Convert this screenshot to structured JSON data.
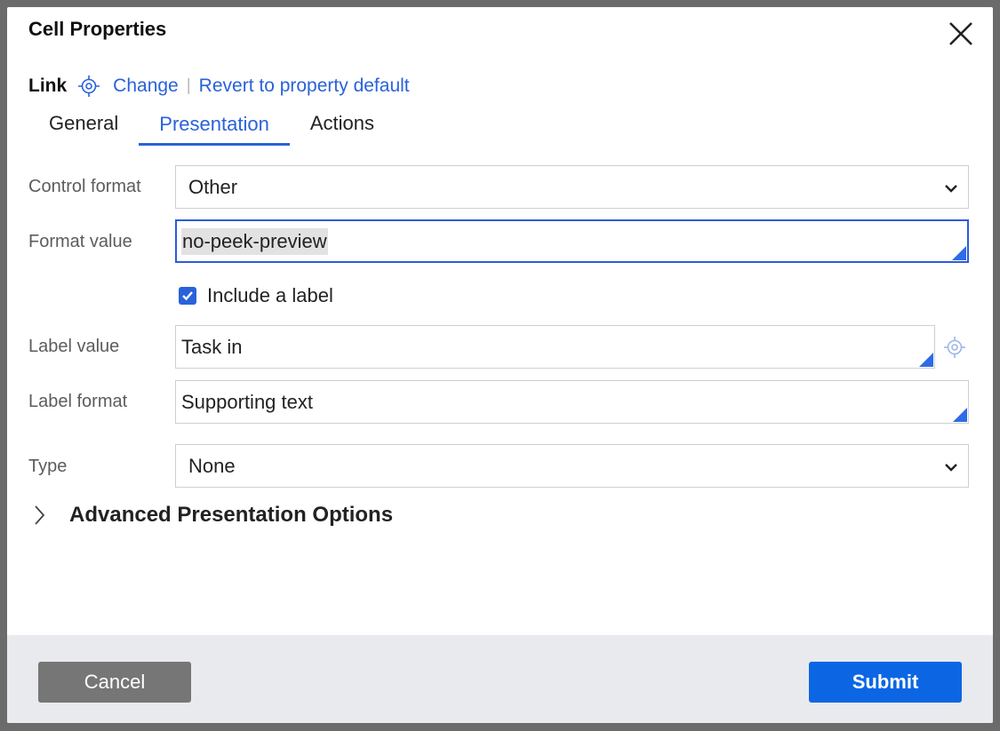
{
  "dialog": {
    "title": "Cell Properties"
  },
  "link": {
    "label": "Link",
    "change": "Change",
    "separator": "|",
    "revert": "Revert to property default"
  },
  "tabs": [
    {
      "label": "General",
      "active": false
    },
    {
      "label": "Presentation",
      "active": true
    },
    {
      "label": "Actions",
      "active": false
    }
  ],
  "fields": {
    "control_format": {
      "label": "Control format",
      "value": "Other"
    },
    "format_value": {
      "label": "Format value",
      "value": "no-peek-preview"
    },
    "include_label": {
      "label": "Include a label",
      "checked": true
    },
    "label_value": {
      "label": "Label value",
      "value": "Task in"
    },
    "label_format": {
      "label": "Label format",
      "value": "Supporting text"
    },
    "type": {
      "label": "Type",
      "value": "None"
    }
  },
  "advanced": {
    "label": "Advanced Presentation Options"
  },
  "footer": {
    "cancel": "Cancel",
    "submit": "Submit"
  },
  "colors": {
    "accent": "#2962d9",
    "submit": "#0c66e4",
    "cancel": "#767676",
    "footer_bg": "#e9eaee"
  }
}
